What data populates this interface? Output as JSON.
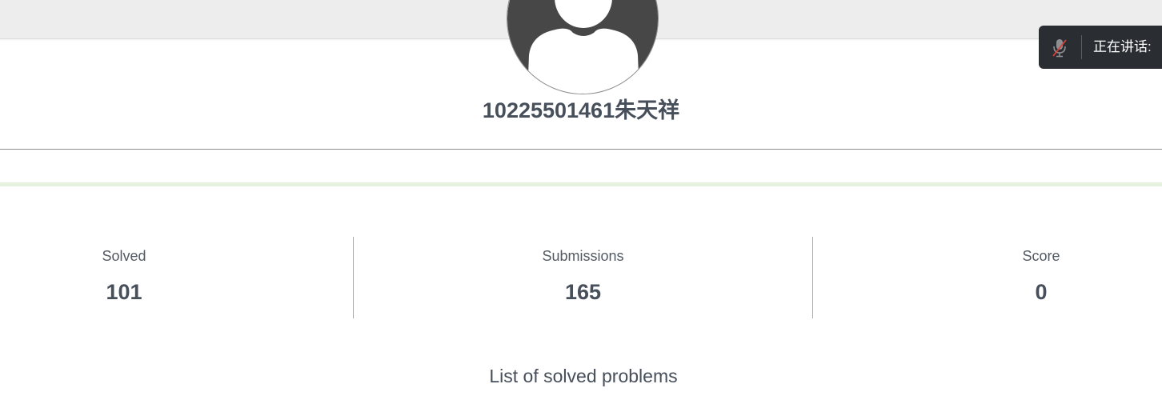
{
  "profile": {
    "username": "10225501461朱天祥",
    "avatar_icon": "default-user-avatar-icon"
  },
  "stats": [
    {
      "label": "Solved",
      "value": "101"
    },
    {
      "label": "Submissions",
      "value": "165"
    },
    {
      "label": "Score",
      "value": "0"
    }
  ],
  "solved_section": {
    "title": "List of solved problems"
  },
  "meeting_widget": {
    "mic_icon": "mic-muted-icon",
    "speaking_label": "正在讲话:"
  },
  "colors": {
    "text_dark": "#474f5b",
    "widget_bg": "#2a2d32",
    "accent_green_line": "#e5f2df",
    "avatar_fill": "#474747"
  }
}
